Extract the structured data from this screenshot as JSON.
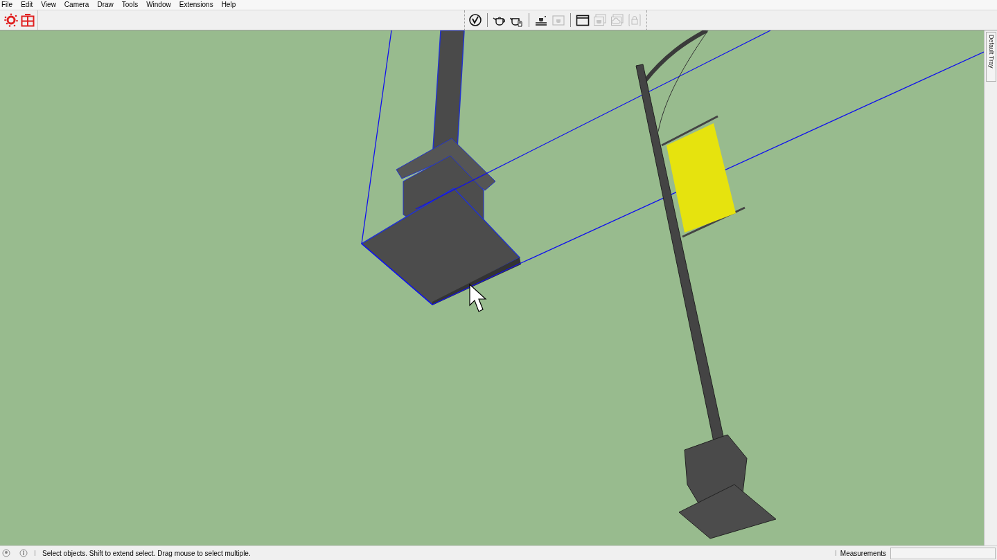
{
  "menu_bar": [
    {
      "label": "File"
    },
    {
      "label": "Edit"
    },
    {
      "label": "View"
    },
    {
      "label": "Camera"
    },
    {
      "label": "Draw"
    },
    {
      "label": "Tools"
    },
    {
      "label": "Window"
    },
    {
      "label": "Extensions"
    },
    {
      "label": "Help"
    }
  ],
  "left_toolbar": [
    {
      "kind": "burst",
      "disabled": false
    },
    {
      "kind": "grid",
      "disabled": false
    }
  ],
  "center_toolbar": [
    {
      "kind": "logo",
      "disabled": false
    },
    {
      "kind": "separator"
    },
    {
      "kind": "teapot",
      "disabled": false
    },
    {
      "kind": "teapot-hand",
      "disabled": false
    },
    {
      "kind": "separator"
    },
    {
      "kind": "teapot-line",
      "disabled": false
    },
    {
      "kind": "frame",
      "disabled": true
    },
    {
      "kind": "separator"
    },
    {
      "kind": "window",
      "disabled": false
    },
    {
      "kind": "window-teapot",
      "disabled": true
    },
    {
      "kind": "cloud",
      "disabled": true
    },
    {
      "kind": "lock",
      "disabled": true
    }
  ],
  "tray": {
    "label": "Default Tray"
  },
  "status_bar": {
    "message": "Select objects. Shift to extend select. Drag mouse to select multiple.",
    "measurements_label": "Measurements"
  }
}
